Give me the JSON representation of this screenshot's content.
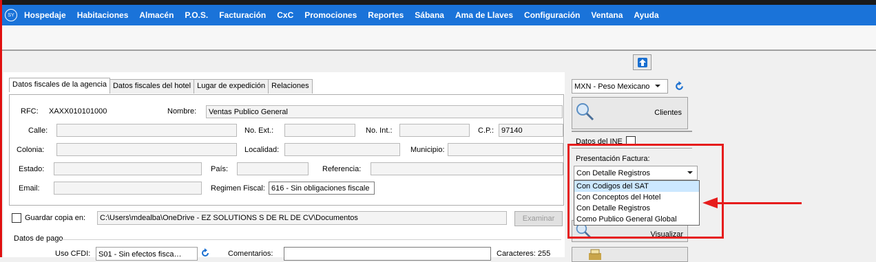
{
  "menu": {
    "logo": "SY",
    "items": [
      "Hospedaje",
      "Habitaciones",
      "Almacén",
      "P.O.S.",
      "Facturación",
      "CxC",
      "Promociones",
      "Reportes",
      "Sábana",
      "Ama de Llaves",
      "Configuración",
      "Ventana",
      "Ayuda"
    ]
  },
  "tabs": [
    "Datos fiscales de la agencia",
    "Datos fiscales del hotel",
    "Lugar de expedición",
    "Relaciones"
  ],
  "form": {
    "rfc_label": "RFC:",
    "rfc_value": "XAXX010101000",
    "nombre_label": "Nombre:",
    "nombre_value": "Ventas Publico General",
    "calle_label": "Calle:",
    "no_ext_label": "No. Ext.:",
    "no_int_label": "No. Int.:",
    "cp_label": "C.P.:",
    "cp_value": "97140",
    "colonia_label": "Colonia:",
    "localidad_label": "Localidad:",
    "municipio_label": "Municipio:",
    "estado_label": "Estado:",
    "pais_label": "País:",
    "referencia_label": "Referencia:",
    "email_label": "Email:",
    "regimen_label": "Regimen Fiscal:",
    "regimen_value": "616 - Sin obligaciones fiscale"
  },
  "guardar": {
    "label": "Guardar copia en:",
    "path": "C:\\Users\\mdealba\\OneDrive - EZ SOLUTIONS S DE RL DE CV\\Documentos",
    "examinar": "Examinar"
  },
  "pago": {
    "section": "Datos de pago",
    "uso_cfdi_label": "Uso CFDI:",
    "uso_cfdi_value": "S01 - Sin efectos fisca…",
    "comentarios_label": "Comentarios:",
    "caracteres": "Caracteres: 255"
  },
  "sidebar": {
    "currency": "MXN - Peso Mexicano",
    "clientes": "Clientes",
    "ine_label": "Datos del INE",
    "presentacion_label": "Presentación Factura:",
    "presentacion_value": "Con Detalle Registros",
    "visualizar": "Visualizar"
  },
  "dropdown_options": [
    "Con Codigos del SAT",
    "Con Conceptos del Hotel",
    "Con Detalle Registros",
    "Como Publico General Global"
  ],
  "colors": {
    "menu_bg": "#1a73d9",
    "highlight": "#cce8ff",
    "annotation": "#e61c1c"
  },
  "icons": {
    "up": "arrow-up-icon",
    "refresh": "refresh-icon",
    "search": "magnifier-icon"
  }
}
